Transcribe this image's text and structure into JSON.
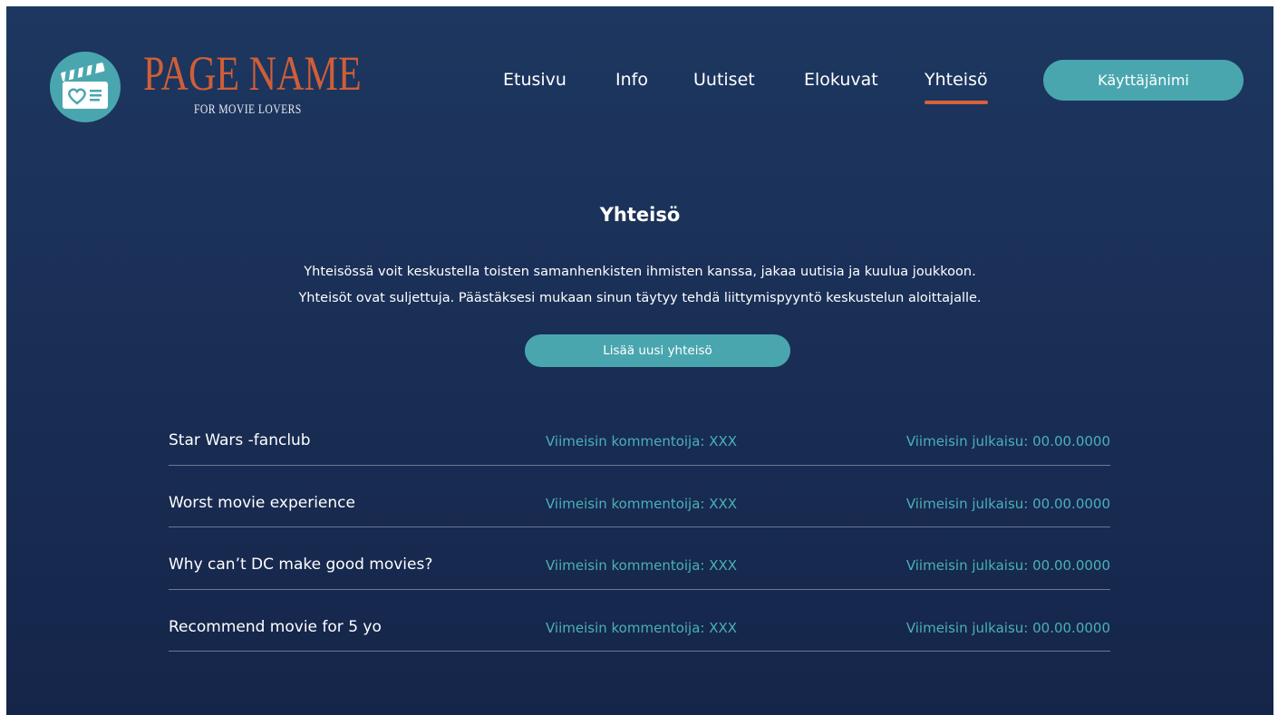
{
  "header": {
    "logo_title": "PAGE NAME",
    "logo_subtitle": "FOR MOVIE LOVERS",
    "logo_icon": "clapperboard-heart-icon",
    "nav": [
      {
        "label": "Etusivu",
        "active": false
      },
      {
        "label": "Info",
        "active": false
      },
      {
        "label": "Uutiset",
        "active": false
      },
      {
        "label": "Elokuvat",
        "active": false
      },
      {
        "label": "Yhteisö",
        "active": true
      }
    ],
    "user_button_label": "Käyttäjänimi"
  },
  "main": {
    "title": "Yhteisö",
    "description_line1": "Yhteisössä voit keskustella toisten samanhenkisten ihmisten kanssa, jakaa uutisia ja kuulua joukkoon.",
    "description_line2": "Yhteisöt ovat suljettuja. Päästäksesi mukaan sinun täytyy tehdä liittymispyyntö keskustelun aloittajalle.",
    "add_button_label": "Lisää uusi yhteisö",
    "communities": [
      {
        "name": "Star Wars -fanclub",
        "commenter": "Viimeisin kommentoija: XXX",
        "published": "Viimeisin julkaisu: 00.00.0000"
      },
      {
        "name": "Worst movie experience",
        "commenter": "Viimeisin kommentoija: XXX",
        "published": "Viimeisin julkaisu: 00.00.0000"
      },
      {
        "name": "Why can’t DC make good movies?",
        "commenter": "Viimeisin kommentoija: XXX",
        "published": "Viimeisin julkaisu: 00.00.0000"
      },
      {
        "name": "Recommend movie for 5 yo",
        "commenter": "Viimeisin kommentoija: XXX",
        "published": "Viimeisin julkaisu: 00.00.0000"
      }
    ]
  },
  "colors": {
    "background_top": "#1d3760",
    "background_bottom": "#15254a",
    "accent_teal": "#4aa6ae",
    "accent_orange": "#d05e37"
  }
}
